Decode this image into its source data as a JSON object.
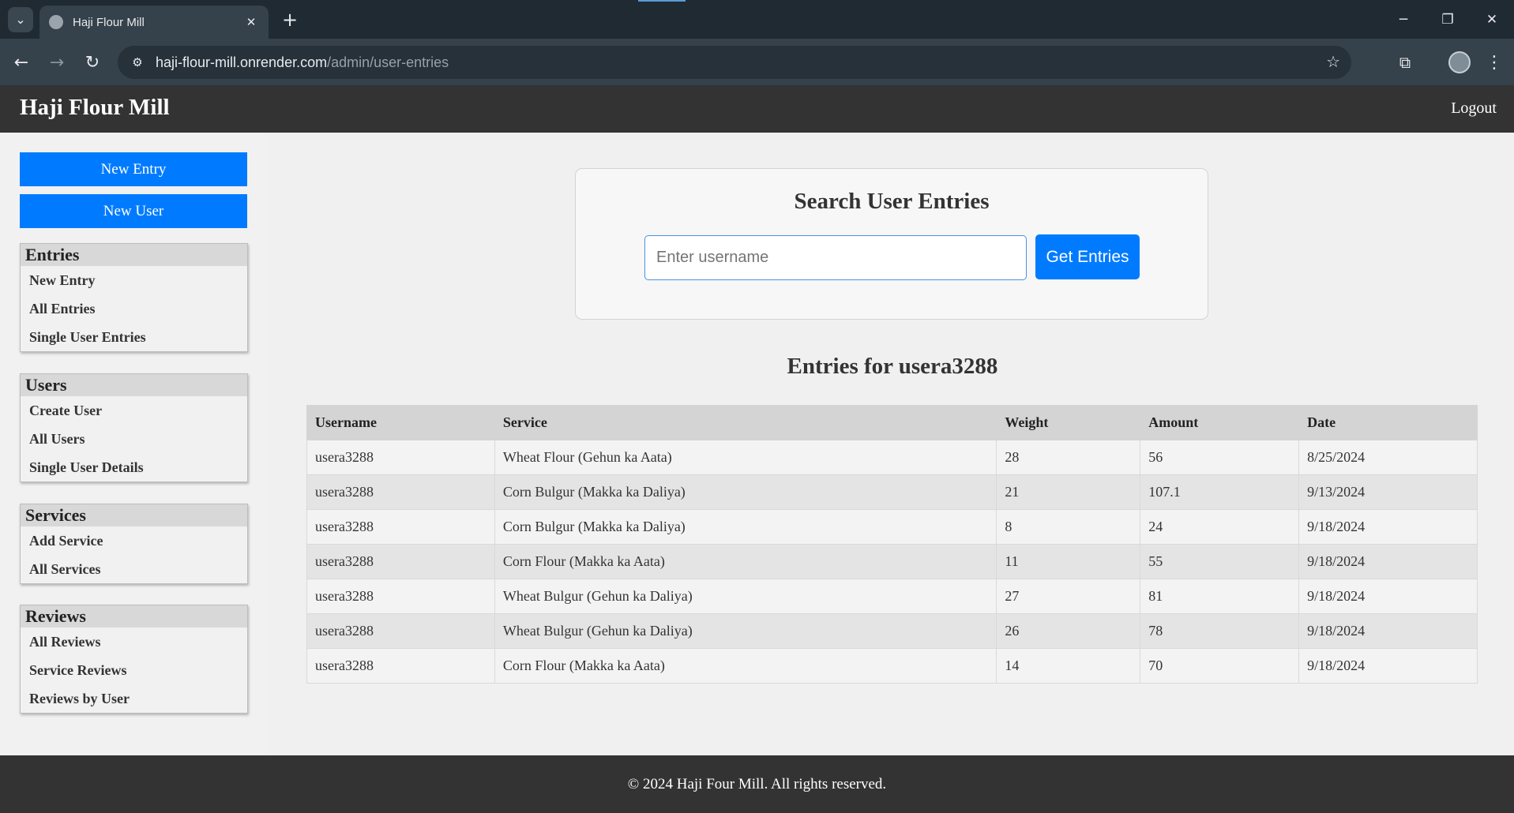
{
  "browser": {
    "tab_title": "Haji Flour Mill",
    "url_host": "haji-flour-mill.onrender.com",
    "url_path": "/admin/user-entries",
    "icons": {
      "tab_menu": "chevron-down-icon",
      "tab_close": "close-icon",
      "new_tab": "plus-icon",
      "back": "arrow-left-icon",
      "forward": "arrow-right-icon",
      "reload": "reload-icon",
      "site_info": "tune-icon",
      "bookmark": "star-icon",
      "extensions": "puzzle-icon",
      "menu": "kebab-icon"
    }
  },
  "header": {
    "brand": "Haji Flour Mill",
    "logout": "Logout"
  },
  "sidebar": {
    "buttons": [
      "New Entry",
      "New User"
    ],
    "groups": [
      {
        "title": "Entries",
        "links": [
          "New Entry",
          "All Entries",
          "Single User Entries"
        ]
      },
      {
        "title": "Users",
        "links": [
          "Create User",
          "All Users",
          "Single User Details"
        ]
      },
      {
        "title": "Services",
        "links": [
          "Add Service",
          "All Services"
        ]
      },
      {
        "title": "Reviews",
        "links": [
          "All Reviews",
          "Service Reviews",
          "Reviews by User"
        ]
      }
    ]
  },
  "search": {
    "title": "Search User Entries",
    "placeholder": "Enter username",
    "value": "",
    "button": "Get Entries"
  },
  "entries": {
    "title": "Entries for usera3288",
    "columns": [
      "Username",
      "Service",
      "Weight",
      "Amount",
      "Date"
    ],
    "rows": [
      [
        "usera3288",
        "Wheat Flour (Gehun ka Aata)",
        "28",
        "56",
        "8/25/2024"
      ],
      [
        "usera3288",
        "Corn Bulgur (Makka ka Daliya)",
        "21",
        "107.1",
        "9/13/2024"
      ],
      [
        "usera3288",
        "Corn Bulgur (Makka ka Daliya)",
        "8",
        "24",
        "9/18/2024"
      ],
      [
        "usera3288",
        "Corn Flour (Makka ka Aata)",
        "11",
        "55",
        "9/18/2024"
      ],
      [
        "usera3288",
        "Wheat Bulgur (Gehun ka Daliya)",
        "27",
        "81",
        "9/18/2024"
      ],
      [
        "usera3288",
        "Wheat Bulgur (Gehun ka Daliya)",
        "26",
        "78",
        "9/18/2024"
      ],
      [
        "usera3288",
        "Corn Flour (Makka ka Aata)",
        "14",
        "70",
        "9/18/2024"
      ]
    ]
  },
  "footer": {
    "text": "© 2024 Haji Four Mill. All rights reserved."
  },
  "colors": {
    "primary": "#007bff",
    "header_bg": "#333333",
    "table_header_bg": "#d4d4d4"
  }
}
